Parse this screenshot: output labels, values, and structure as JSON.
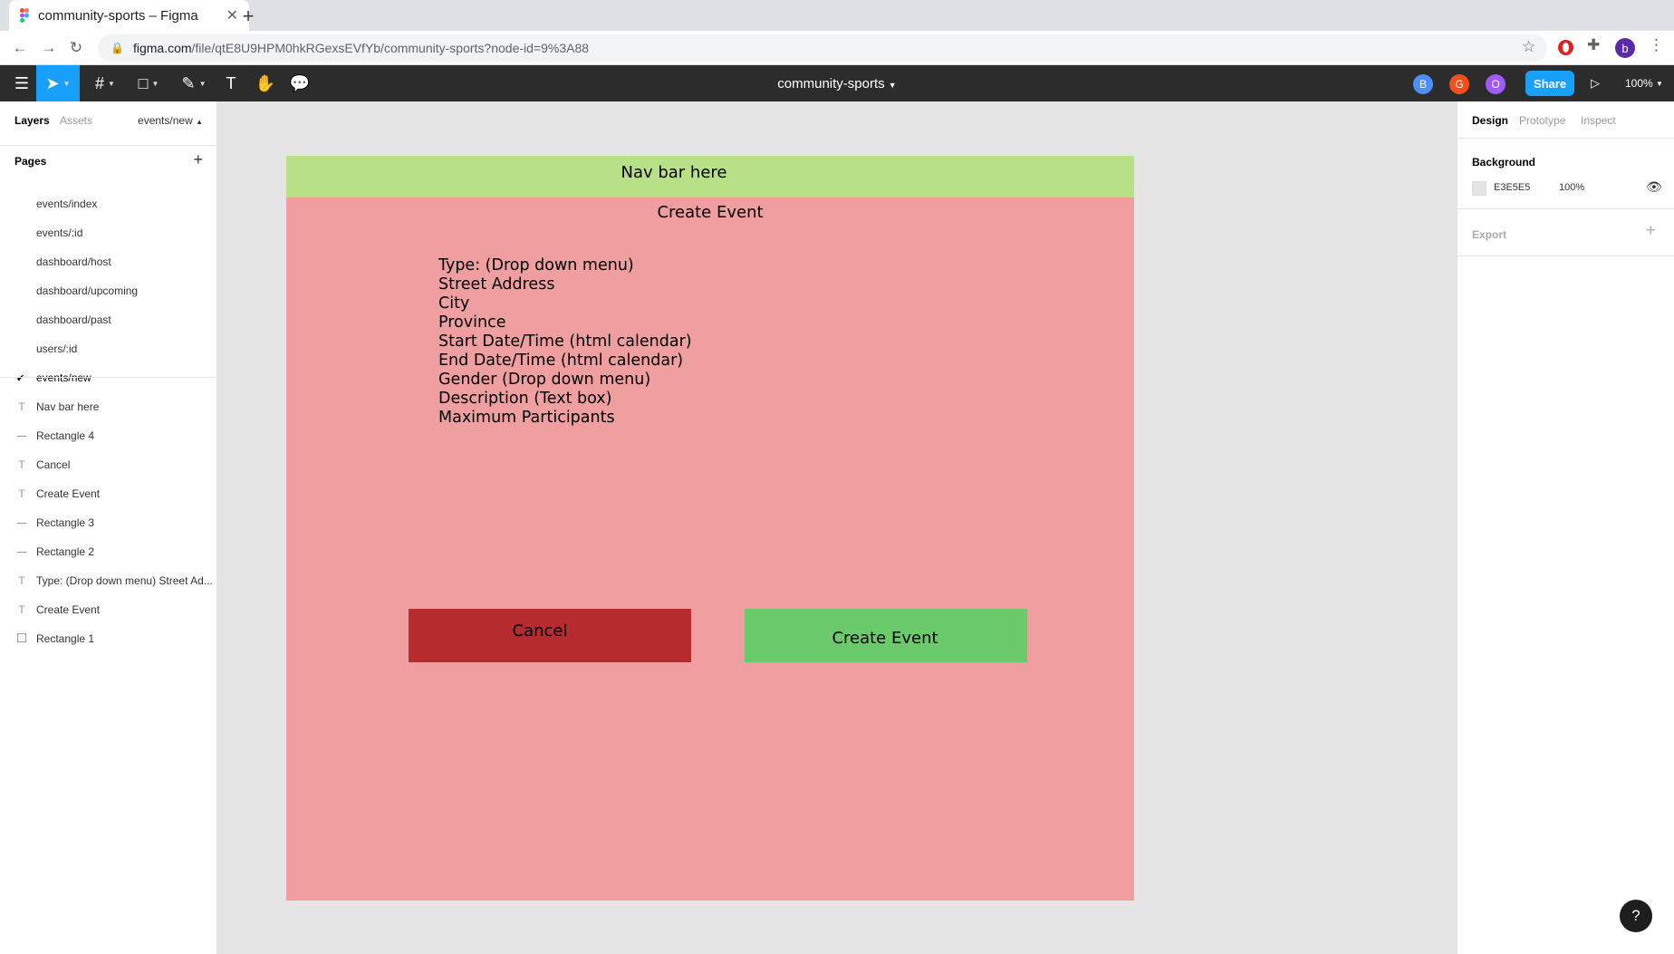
{
  "browser": {
    "tab_title": "community-sports – Figma",
    "url_host": "figma.com",
    "url_path": "/file/qtE8U9HPM0hkRGexsEVfYb/community-sports?node-id=9%3A88",
    "profile_initial": "b"
  },
  "toolbar": {
    "file_name": "community-sports",
    "collaborators": [
      {
        "initial": "B",
        "color": "#4e8ef7"
      },
      {
        "initial": "G",
        "color": "#f24e1e"
      },
      {
        "initial": "O",
        "color": "#a259ff"
      }
    ],
    "share_label": "Share",
    "zoom_label": "100%"
  },
  "left_panel": {
    "tab_layers": "Layers",
    "tab_assets": "Assets",
    "current_page": "events/new",
    "pages_heading": "Pages",
    "pages": [
      {
        "label": "events/index"
      },
      {
        "label": "events/:id"
      },
      {
        "label": "dashboard/host"
      },
      {
        "label": "dashboard/upcoming"
      },
      {
        "label": "dashboard/past"
      },
      {
        "label": "users/:id"
      },
      {
        "label": "events/new"
      }
    ],
    "layers": [
      {
        "label": "Nav bar here",
        "type": "text"
      },
      {
        "label": "Rectangle 4",
        "type": "line"
      },
      {
        "label": "Cancel",
        "type": "text"
      },
      {
        "label": "Create Event",
        "type": "text"
      },
      {
        "label": "Rectangle 3",
        "type": "line"
      },
      {
        "label": "Rectangle 2",
        "type": "line"
      },
      {
        "label": "Type: (Drop down menu) Street Ad...",
        "type": "text"
      },
      {
        "label": "Create Event",
        "type": "text"
      },
      {
        "label": "Rectangle 1",
        "type": "rect"
      }
    ]
  },
  "canvas": {
    "nav_text": "Nav bar here",
    "title": "Create Event",
    "fields": [
      "Type: (Drop down menu)",
      "Street Address",
      "City",
      "Province",
      "Start Date/Time (html calendar)",
      "End Date/Time (html calendar)",
      "Gender (Drop down menu)",
      "Description (Text box)",
      "Maximum Participants"
    ],
    "cancel_label": "Cancel",
    "create_label": "Create Event"
  },
  "right_panel": {
    "tab_design": "Design",
    "tab_prototype": "Prototype",
    "tab_inspect": "Inspect",
    "background_heading": "Background",
    "background_hex": "E3E5E5",
    "background_opacity": "100%",
    "export_heading": "Export"
  },
  "help_label": "?"
}
